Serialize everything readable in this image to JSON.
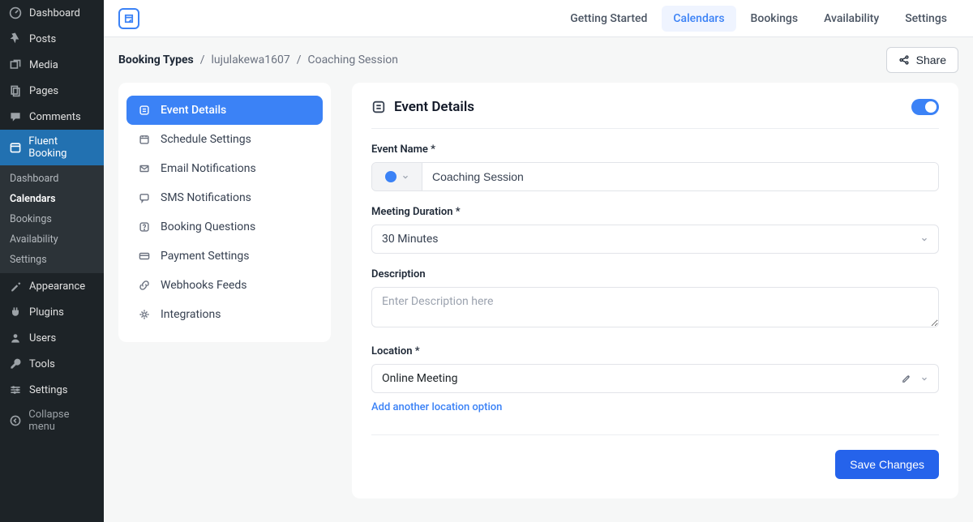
{
  "wp_sidebar": {
    "items": [
      {
        "label": "Dashboard",
        "icon": "dashboard-icon"
      },
      {
        "label": "Posts",
        "icon": "pin-icon"
      },
      {
        "label": "Media",
        "icon": "media-icon"
      },
      {
        "label": "Pages",
        "icon": "pages-icon"
      },
      {
        "label": "Comments",
        "icon": "comment-icon"
      },
      {
        "label": "Fluent Booking",
        "icon": "calendar-icon"
      },
      {
        "label": "Appearance",
        "icon": "brush-icon"
      },
      {
        "label": "Plugins",
        "icon": "plug-icon"
      },
      {
        "label": "Users",
        "icon": "user-icon"
      },
      {
        "label": "Tools",
        "icon": "wrench-icon"
      },
      {
        "label": "Settings",
        "icon": "sliders-icon"
      },
      {
        "label": "Collapse menu",
        "icon": "collapse-icon"
      }
    ],
    "sub": [
      "Dashboard",
      "Calendars",
      "Bookings",
      "Availability",
      "Settings"
    ]
  },
  "topnav": [
    "Getting Started",
    "Calendars",
    "Bookings",
    "Availability",
    "Settings"
  ],
  "breadcrumb": {
    "root": "Booking Types",
    "user": "lujulakewa1607",
    "page": "Coaching Session"
  },
  "share_label": "Share",
  "tabs": [
    "Event Details",
    "Schedule Settings",
    "Email Notifications",
    "SMS Notifications",
    "Booking Questions",
    "Payment Settings",
    "Webhooks Feeds",
    "Integrations"
  ],
  "form": {
    "heading": "Event Details",
    "enabled": true,
    "event_name_label": "Event Name *",
    "event_name_value": "Coaching Session",
    "event_color": "#3b82f6",
    "duration_label": "Meeting Duration *",
    "duration_value": "30 Minutes",
    "description_label": "Description",
    "description_placeholder": "Enter Description here",
    "description_value": "",
    "location_label": "Location *",
    "location_value": "Online Meeting",
    "add_location_label": "Add another location option",
    "save_label": "Save Changes"
  }
}
